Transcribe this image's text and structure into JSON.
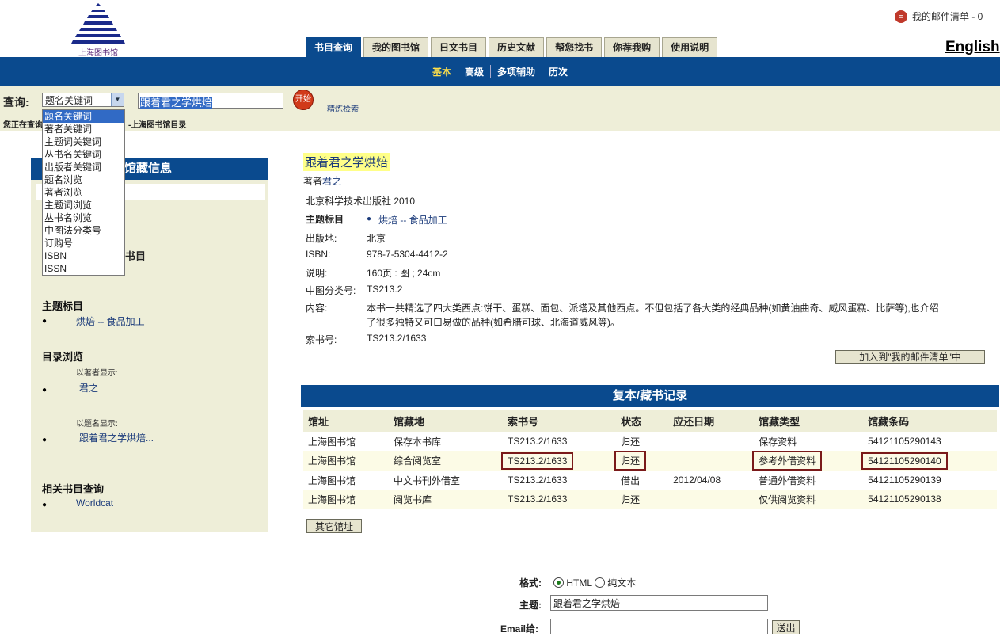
{
  "header": {
    "logo_text": "上海图书馆",
    "mail_list": "我的邮件清单 - 0",
    "english": "English",
    "tabs": [
      "书目查询",
      "我的图书馆",
      "日文书目",
      "历史文献",
      "帮您找书",
      "你荐我购",
      "使用说明"
    ]
  },
  "subnav": [
    "基本",
    "高级",
    "多项辅助",
    "历次"
  ],
  "search": {
    "label": "查询:",
    "selected": "题名关键词",
    "value": "跟着君之学烘焙",
    "go": "开始",
    "refine": "精炼检索",
    "searching_prefix": "您正在查询",
    "searching_suffix": "图书馆目录",
    "searching_end": "-上海图书馆目录",
    "options": [
      "题名关键词",
      "著者关键词",
      "主题词关键词",
      "丛书名关键词",
      "出版者关键词",
      "题名浏览",
      "著者浏览",
      "主题词浏览",
      "丛书名浏览",
      "中图法分类号",
      "订购号",
      "ISBN",
      "ISSN"
    ]
  },
  "left": {
    "head": "馆藏信息",
    "booklist": "书目",
    "subject_heading": "主题标目",
    "subject_item": "烘焙 -- 食品加工",
    "browse_heading": "目录浏览",
    "by_author": "以著者显示:",
    "author_item": "君之",
    "by_title": "以题名显示:",
    "title_item": "跟着君之学烘焙...",
    "related_heading": "相关书目查询",
    "related_item": "Worldcat"
  },
  "book": {
    "title": "跟着君之学烘焙",
    "author_prefix": "著者",
    "author": "君之",
    "publisher": "北京科学技术出版社 2010",
    "subject_label": "主题标目",
    "subject": "烘焙 -- 食品加工",
    "place_label": "出版地:",
    "place": "北京",
    "isbn_label": "ISBN:",
    "isbn": "978-7-5304-4412-2",
    "desc_label": "说明:",
    "desc": "160页 : 图 ; 24cm",
    "class_label": "中图分类号:",
    "class": "TS213.2",
    "content_label": "内容:",
    "content_line1": "本书一共精选了四大类西点:饼干、蛋糕、面包、派塔及其他西点。不但包括了各大类的经典品种(如黄油曲奇、威风蛋糕、比萨等),也介绍",
    "content_line2": "了很多独特又可口易做的品种(如希腊可球、北海道威风等)。",
    "callno_label": "索书号:",
    "callno": "TS213.2/1633",
    "add_mail": "加入到\"我的邮件清单\"中"
  },
  "holdings": {
    "head": "复本/藏书记录",
    "columns": [
      "馆址",
      "馆藏地",
      "索书号",
      "状态",
      "应还日期",
      "馆藏类型",
      "馆藏条码"
    ],
    "rows": [
      [
        "上海图书馆",
        "保存本书库",
        "TS213.2/1633",
        "归还",
        "",
        "保存资料",
        "54121105290143"
      ],
      [
        "上海图书馆",
        "综合阅览室",
        "TS213.2/1633",
        "归还",
        "",
        "参考外借资料",
        "54121105290140"
      ],
      [
        "上海图书馆",
        "中文书刊外借室",
        "TS213.2/1633",
        "借出",
        "2012/04/08",
        "普通外借资料",
        "54121105290139"
      ],
      [
        "上海图书馆",
        "阅览书库",
        "TS213.2/1633",
        "归还",
        "",
        "仅供阅览资料",
        "54121105290138"
      ]
    ],
    "other_libs": "其它馆址"
  },
  "email_form": {
    "format_label": "格式:",
    "html": "HTML",
    "text": "纯文本",
    "subject_label": "主题:",
    "subject_value": "跟着君之学烘焙",
    "email_label": "Email给:",
    "send": "送出"
  },
  "colors": {
    "brand_blue": "#0a4a8e",
    "panel_beige": "#eeeed8",
    "highlight": "#ffff88"
  }
}
